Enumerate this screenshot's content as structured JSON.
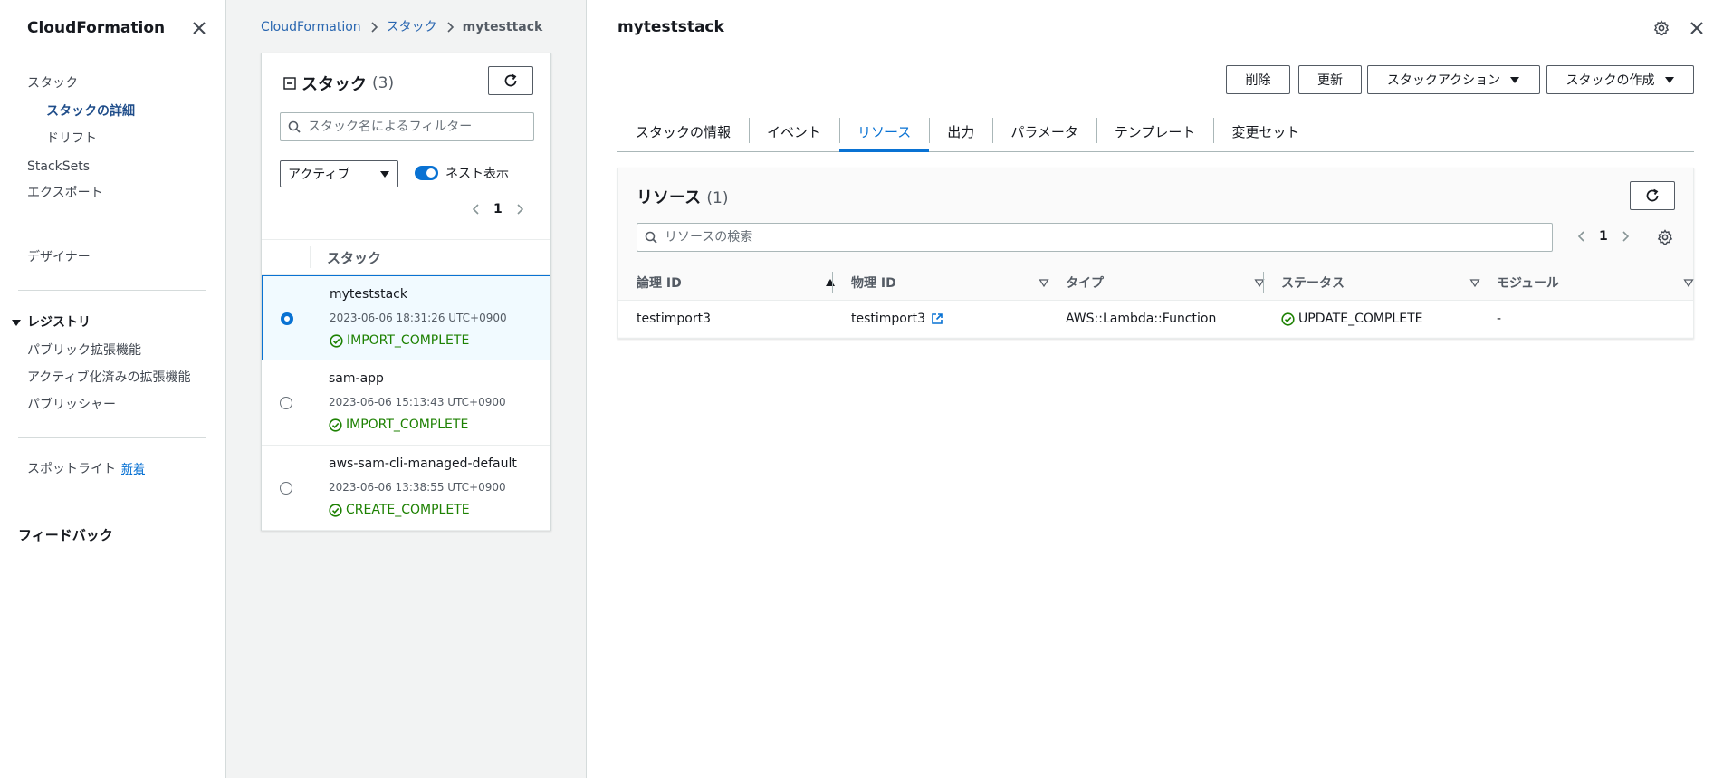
{
  "nav": {
    "title": "CloudFormation",
    "items": {
      "stacks": "スタック",
      "stack_details": "スタックの詳細",
      "drift": "ドリフト",
      "stacksets": "StackSets",
      "exports": "エクスポート",
      "designer": "デザイナー",
      "registry": "レジストリ",
      "public_extensions": "パブリック拡張機能",
      "activated_extensions": "アクティブ化済みの拡張機能",
      "publisher": "パブリッシャー",
      "spotlight": "スポットライト",
      "spotlight_badge": "新着",
      "feedback": "フィードバック"
    }
  },
  "breadcrumb": {
    "root": "CloudFormation",
    "stacks": "スタック",
    "current": "mytesttack"
  },
  "stack_list": {
    "title": "スタック",
    "count": "(3)",
    "filter_placeholder": "スタック名によるフィルター",
    "status_filter": "アクティブ",
    "nested_toggle_label": "ネスト表示",
    "page": "1",
    "column_header": "スタック",
    "rows": [
      {
        "name": "myteststack",
        "time": "2023-06-06 18:31:26 UTC+0900",
        "status": "IMPORT_COMPLETE"
      },
      {
        "name": "sam-app",
        "time": "2023-06-06 15:13:43 UTC+0900",
        "status": "IMPORT_COMPLETE"
      },
      {
        "name": "aws-sam-cli-managed-default",
        "time": "2023-06-06 13:38:55 UTC+0900",
        "status": "CREATE_COMPLETE"
      }
    ]
  },
  "detail": {
    "title": "myteststack",
    "buttons": {
      "delete": "削除",
      "update": "更新",
      "stack_actions": "スタックアクション",
      "create_stack": "スタックの作成"
    },
    "tabs": [
      "スタックの情報",
      "イベント",
      "リソース",
      "出力",
      "パラメータ",
      "テンプレート",
      "変更セット"
    ],
    "active_tab": "リソース"
  },
  "resources": {
    "title": "リソース",
    "count": "(1)",
    "search_placeholder": "リソースの検索",
    "page": "1",
    "columns": [
      "論理 ID",
      "物理 ID",
      "タイプ",
      "ステータス",
      "モジュール"
    ],
    "rows": [
      {
        "logical_id": "testimport3",
        "physical_id": "testimport3",
        "type": "AWS::Lambda::Function",
        "status": "UPDATE_COMPLETE",
        "module": "-"
      }
    ]
  },
  "colors": {
    "link": "#0972d3",
    "success": "#1d8102",
    "selected_bg": "#f1faff"
  }
}
